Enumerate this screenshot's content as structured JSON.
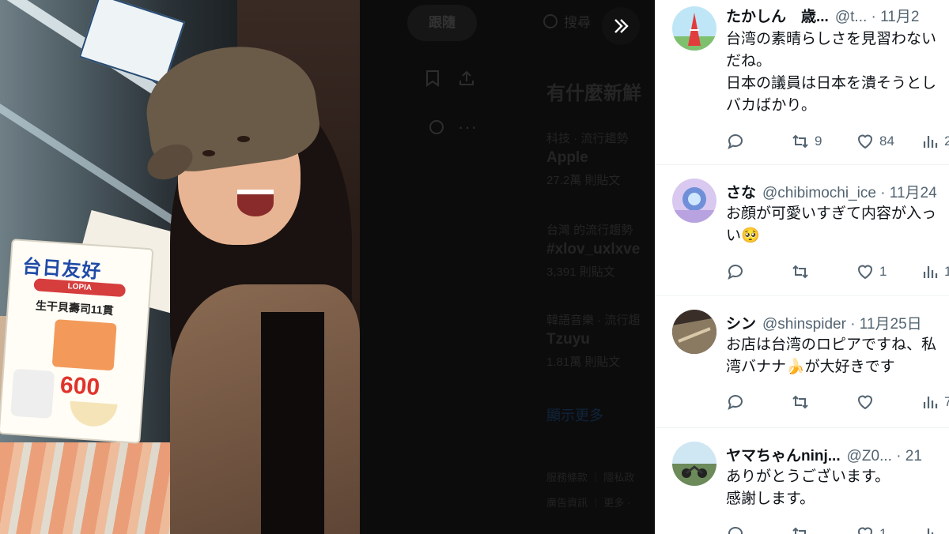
{
  "photo": {
    "sign": {
      "title": "台日友好",
      "ribbon": "LOPIA",
      "subtitle": "生干貝壽司11貫",
      "price": "600"
    }
  },
  "middle": {
    "follow_label": "跟隨",
    "search_label": "搜尋",
    "trends_title": "有什麼新鮮",
    "trends": [
      {
        "category": "科技 · 流行趨勢",
        "name": "Apple",
        "count": "27.2萬 則貼文"
      },
      {
        "category": "台灣 的流行趨勢",
        "name": "#xlov_uxlxve",
        "count": "3,391 則貼文"
      },
      {
        "category": "韓語音樂 · 流行趨",
        "name": "Tzuyu",
        "count": "1.81萬 則貼文"
      }
    ],
    "show_more": "顯示更多",
    "footer_line1": "服務條款 ｜ 隱私政",
    "footer_line2": "廣告資訊 ｜ 更多 ·"
  },
  "replies": [
    {
      "name": "たかしん　歳...",
      "handle": "@t...",
      "date": "· 11月2",
      "text": "台湾の素晴らしさを見習わない\nだね。\n日本の議員は日本を潰そうとし\nバカばかり。",
      "replies_count": "",
      "retweets": "9",
      "likes": "84",
      "views": "2"
    },
    {
      "name": "さな",
      "handle": "@chibimochi_ice",
      "date": "· 11月24",
      "text": "お顔が可愛いすぎて内容が入っ\nい🥺",
      "replies_count": "",
      "retweets": "",
      "likes": "1",
      "views": "1"
    },
    {
      "name": "シン",
      "handle": "@shinspider",
      "date": "· 11月25日",
      "text": "お店は台湾のロピアですね、私\n湾バナナ🍌が大好きです",
      "replies_count": "",
      "retweets": "",
      "likes": "",
      "views": "7"
    },
    {
      "name": "ヤマちゃんninj...",
      "handle": "@Z0...",
      "date": "· 21 ",
      "text": "ありがとうございます。\n感謝します。",
      "replies_count": "",
      "retweets": "",
      "likes": "1",
      "views": ""
    }
  ]
}
